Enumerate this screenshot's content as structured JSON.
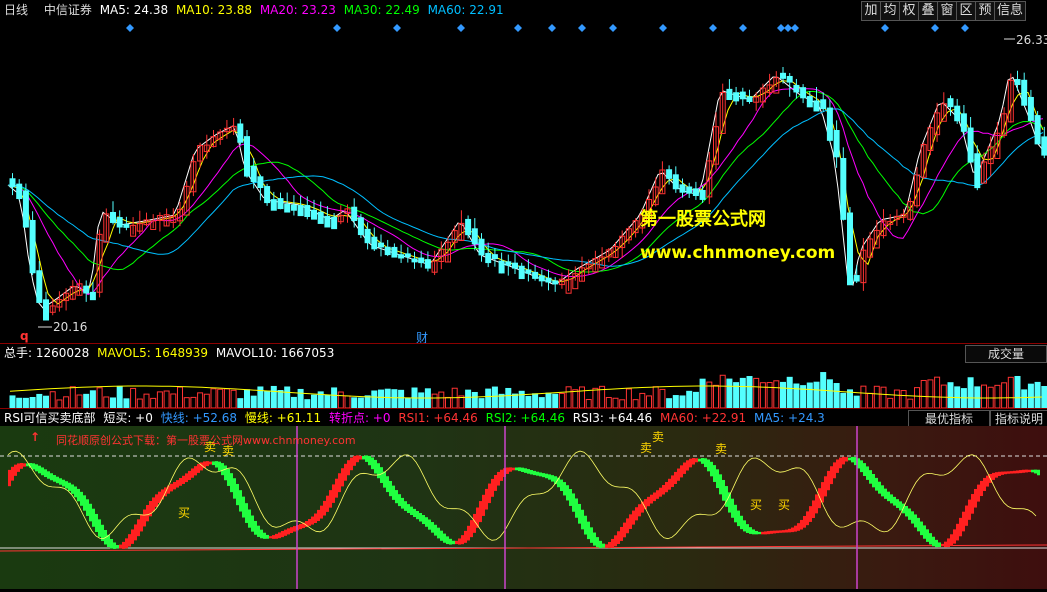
{
  "top": {
    "period": "日线",
    "stock": "中信证券",
    "ma": [
      {
        "label": "MA5: 24.38",
        "color": "#ffffff"
      },
      {
        "label": "MA10: 23.88",
        "color": "#ffff00"
      },
      {
        "label": "MA20: 23.23",
        "color": "#ff00ff"
      },
      {
        "label": "MA30: 22.49",
        "color": "#00ff00"
      },
      {
        "label": "MA60: 22.91",
        "color": "#00bfff"
      }
    ],
    "buttons": [
      "加",
      "均",
      "权",
      "叠",
      "窗",
      "区",
      "预",
      "信息"
    ],
    "high_label": "26.33",
    "low_label": "20.16",
    "q_marker": "q",
    "cai_marker": "财"
  },
  "watermark": {
    "line1": "第一股票公式网",
    "line2": "www.chnmoney.com"
  },
  "volume": {
    "total": "总手: 1260028",
    "mavol5": "MAVOL5: 1648939",
    "mavol10": "MAVOL10: 1667053",
    "tab": "成交量"
  },
  "indicator": {
    "items": [
      {
        "text": "RSI可信买卖底部",
        "color": "#ffffff"
      },
      {
        "text": "短买: +0",
        "color": "#ffffff"
      },
      {
        "text": "快线: +52.68",
        "color": "#3399ff"
      },
      {
        "text": "慢线: +61.11",
        "color": "#ffff00"
      },
      {
        "text": "转折点: +0",
        "color": "#ff00ff"
      },
      {
        "text": "RSI1: +64.46",
        "color": "#ff3333"
      },
      {
        "text": "RSI2: +64.46",
        "color": "#00ff00"
      },
      {
        "text": "RSI3: +64.46",
        "color": "#ffffff"
      },
      {
        "text": "MA60: +22.91",
        "color": "#ff3333"
      },
      {
        "text": "MA5: +24.3",
        "color": "#3399ff"
      }
    ],
    "tab_best": "最优指标",
    "tab_help": "指标说明",
    "promo": "同花顺原创公式下载：第一股票公式网www.chnmoney.com",
    "sell": "卖",
    "buy": "买"
  },
  "colors": {
    "up": "#ff3333",
    "down": "#54ffff",
    "border": "#8b0000"
  }
}
